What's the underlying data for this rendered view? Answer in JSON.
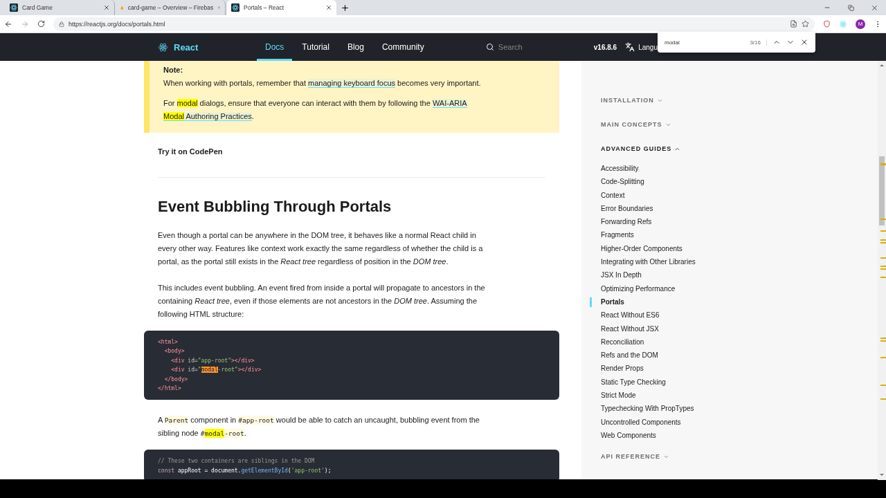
{
  "browser": {
    "tabs": [
      {
        "title": "Card Game",
        "kind": "react",
        "selected": false
      },
      {
        "title": "card-game – Overview – Firebas",
        "kind": "flame",
        "selected": false
      },
      {
        "title": "Portals – React",
        "kind": "react",
        "selected": true
      }
    ],
    "url": "https://reactjs.org/docs/portals.html",
    "profile_initial": "M"
  },
  "find_bar": {
    "query": "modal",
    "count": "3/16"
  },
  "site_nav": {
    "brand": "React",
    "links": [
      {
        "label": "Docs",
        "selected": true
      },
      {
        "label": "Tutorial",
        "selected": false
      },
      {
        "label": "Blog",
        "selected": false
      },
      {
        "label": "Community",
        "selected": false
      }
    ],
    "search_placeholder": "Search",
    "version": "v16.8.6",
    "language": "Langu"
  },
  "article": [
    {
      "kind": "note",
      "title": "Note:",
      "paragraphs": [
        [
          {
            "kind": "text",
            "text": "When working with portals, remember that "
          },
          {
            "kind": "link",
            "text": "managing keyboard focus"
          },
          {
            "kind": "text",
            "text": " becomes very important."
          }
        ],
        [
          {
            "kind": "text",
            "text": "For "
          },
          {
            "kind": "mark",
            "text": "modal"
          },
          {
            "kind": "text",
            "text": " dialogs, ensure that everyone can interact with them by following the "
          },
          {
            "kind": "link",
            "text": "WAI-ARIA"
          },
          {
            "kind": "break-link-mark",
            "text": "Modal"
          },
          {
            "kind": "link",
            "text": " Authoring Practices"
          },
          {
            "kind": "text",
            "text": "."
          }
        ]
      ]
    },
    {
      "kind": "cta",
      "text": "Try it on CodePen"
    },
    {
      "kind": "rule"
    },
    {
      "kind": "heading",
      "text": "Event Bubbling Through Portals"
    },
    {
      "kind": "paragraph",
      "segments": [
        {
          "kind": "text",
          "text": "Even though a portal can be anywhere in the DOM tree, it behaves like a normal React child in every other way. Features like context work exactly the same regardless of whether the child is a portal, as the portal still exists in the "
        },
        {
          "kind": "italic",
          "text": "React tree"
        },
        {
          "kind": "text",
          "text": " regardless of position in the "
        },
        {
          "kind": "italic",
          "text": "DOM tree"
        },
        {
          "kind": "text",
          "text": "."
        }
      ]
    },
    {
      "kind": "paragraph",
      "segments": [
        {
          "kind": "text",
          "text": "This includes event bubbling. An event fired from inside a portal will propagate to ancestors in the containing "
        },
        {
          "kind": "italic",
          "text": "React tree"
        },
        {
          "kind": "text",
          "text": ", even if those elements are not ancestors in the "
        },
        {
          "kind": "italic",
          "text": "DOM tree"
        },
        {
          "kind": "text",
          "text": ". Assuming the following HTML structure:"
        }
      ]
    },
    {
      "kind": "code",
      "lines": [
        [
          {
            "kind": "tag",
            "text": "<html>"
          }
        ],
        [
          {
            "kind": "tag",
            "text": "  <body>"
          }
        ],
        [
          {
            "kind": "tag",
            "text": "    <div"
          },
          {
            "kind": "attr",
            "text": " id="
          },
          {
            "kind": "string",
            "text": "\"app-root\""
          },
          {
            "kind": "tag",
            "text": "></div>"
          }
        ],
        [
          {
            "kind": "tag",
            "text": "    <div"
          },
          {
            "kind": "attr",
            "text": " id="
          },
          {
            "kind": "string",
            "text": "\""
          },
          {
            "kind": "current",
            "text": "modal"
          },
          {
            "kind": "string",
            "text": "-root\""
          },
          {
            "kind": "tag",
            "text": "></div>"
          }
        ],
        [
          {
            "kind": "tag",
            "text": "  </body>"
          }
        ],
        [
          {
            "kind": "tag",
            "text": "</html>"
          }
        ]
      ]
    },
    {
      "kind": "paragraph",
      "segments": [
        {
          "kind": "text",
          "text": "A "
        },
        {
          "kind": "code",
          "text": "Parent"
        },
        {
          "kind": "text",
          "text": " component in "
        },
        {
          "kind": "code",
          "text": "#app-root"
        },
        {
          "kind": "text",
          "text": " would be able to catch an uncaught, bubbling event from the sibling node "
        },
        {
          "kind": "code",
          "text": "#"
        },
        {
          "kind": "code-mark",
          "text": "modal"
        },
        {
          "kind": "code",
          "text": "-root"
        },
        {
          "kind": "text",
          "text": "."
        }
      ]
    },
    {
      "kind": "code",
      "lines": [
        [
          {
            "kind": "comment",
            "text": "// These two containers are siblings in the DOM"
          }
        ],
        [
          {
            "kind": "keyword",
            "text": "const "
          },
          {
            "kind": "plain",
            "text": "appRoot = document."
          },
          {
            "kind": "func",
            "text": "getElementById"
          },
          {
            "kind": "plain",
            "text": "("
          },
          {
            "kind": "string",
            "text": "'app-root'"
          },
          {
            "kind": "plain",
            "text": ");"
          }
        ]
      ]
    }
  ],
  "sidebar": {
    "sections": [
      {
        "title": "INSTALLATION",
        "expanded": false
      },
      {
        "title": "MAIN CONCEPTS",
        "expanded": false
      },
      {
        "title": "ADVANCED GUIDES",
        "expanded": true,
        "items": [
          {
            "label": "Accessibility",
            "selected": false
          },
          {
            "label": "Code-Splitting",
            "selected": false
          },
          {
            "label": "Context",
            "selected": false
          },
          {
            "label": "Error Boundaries",
            "selected": false
          },
          {
            "label": "Forwarding Refs",
            "selected": false
          },
          {
            "label": "Fragments",
            "selected": false
          },
          {
            "label": "Higher-Order Components",
            "selected": false
          },
          {
            "label": "Integrating with Other Libraries",
            "selected": false
          },
          {
            "label": "JSX In Depth",
            "selected": false
          },
          {
            "label": "Optimizing Performance",
            "selected": false
          },
          {
            "label": "Portals",
            "selected": true
          },
          {
            "label": "React Without ES6",
            "selected": false
          },
          {
            "label": "React Without JSX",
            "selected": false
          },
          {
            "label": "Reconciliation",
            "selected": false
          },
          {
            "label": "Refs and the DOM",
            "selected": false
          },
          {
            "label": "Render Props",
            "selected": false
          },
          {
            "label": "Static Type Checking",
            "selected": false
          },
          {
            "label": "Strict Mode",
            "selected": false
          },
          {
            "label": "Typechecking With PropTypes",
            "selected": false
          },
          {
            "label": "Uncontrolled Components",
            "selected": false
          },
          {
            "label": "Web Components",
            "selected": false
          }
        ]
      },
      {
        "title": "API REFERENCE",
        "expanded": false
      }
    ]
  }
}
